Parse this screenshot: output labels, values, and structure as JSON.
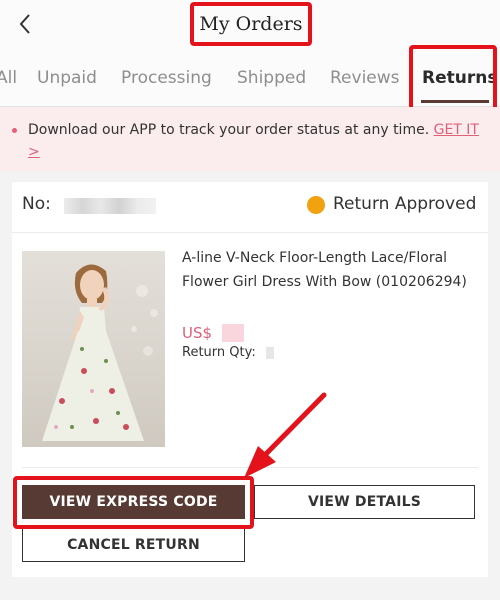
{
  "header": {
    "title": "My Orders",
    "back_icon": "chevron-left-icon"
  },
  "tabs": [
    {
      "label": "All",
      "active": false
    },
    {
      "label": "Unpaid",
      "active": false
    },
    {
      "label": "Processing",
      "active": false
    },
    {
      "label": "Shipped",
      "active": false
    },
    {
      "label": "Reviews",
      "active": false
    },
    {
      "label": "Returns",
      "active": true
    }
  ],
  "notice": {
    "text": "Download our APP to track your order status at any time.",
    "link": "GET IT >"
  },
  "order": {
    "no_label": "No:",
    "status": "Return Approved",
    "status_color": "#f2a20e",
    "product_name": "A-line V-Neck Floor-Length Lace/Floral Flower Girl Dress With Bow (010206294)",
    "price_prefix": "US$",
    "qty_label": "Return Qty:"
  },
  "actions": {
    "view_express_code": "VIEW EXPRESS CODE",
    "view_details": "VIEW DETAILS",
    "cancel_return": "CANCEL RETURN"
  },
  "colors": {
    "highlight": "#e3121b",
    "brand_dark": "#573a33",
    "accent_pink": "#e0607a",
    "notice_bg": "#fbeced"
  }
}
